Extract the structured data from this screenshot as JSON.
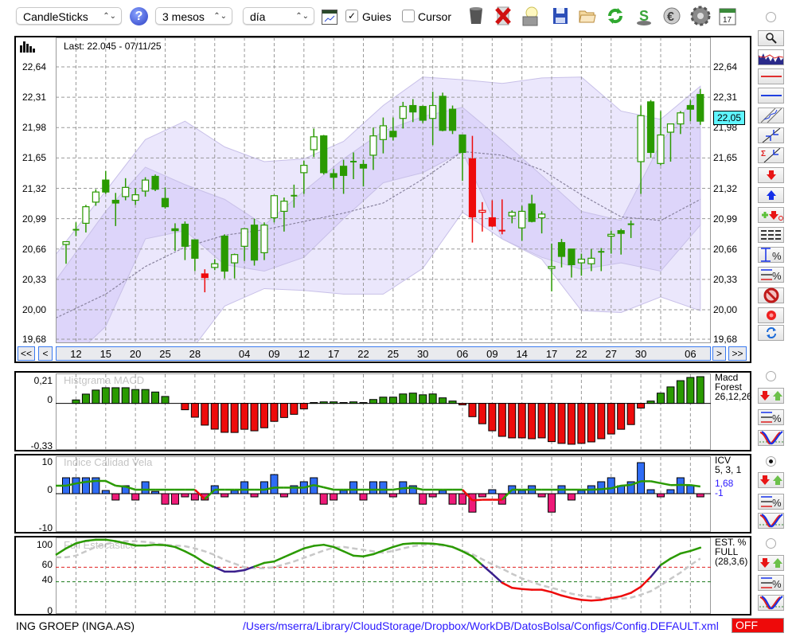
{
  "toolbar": {
    "chart_type": "CandleSticks",
    "period": "3 mesos",
    "interval": "día",
    "guides_label": "Guies",
    "guides_checked": true,
    "cursor_label": "Cursor",
    "cursor_checked": false,
    "icons": [
      "help-icon",
      "chart-window-icon",
      "trash-icon",
      "delete-icon",
      "clear-lamp-icon",
      "save-icon",
      "open-folder-icon",
      "refresh-icon",
      "currency-s-icon",
      "euro-icon",
      "settings-gear-icon",
      "calendar-icon"
    ],
    "calendar_day": "17"
  },
  "main": {
    "last_label": "Last: 22.045 - 07/11/25",
    "last_value_badge": "22,05",
    "y_ticks": [
      {
        "v": 22.64,
        "label": "22,64"
      },
      {
        "v": 22.31,
        "label": "22,31"
      },
      {
        "v": 21.98,
        "label": "21,98"
      },
      {
        "v": 21.65,
        "label": "21,65"
      },
      {
        "v": 21.32,
        "label": "21,32"
      },
      {
        "v": 20.99,
        "label": "20,99"
      },
      {
        "v": 20.66,
        "label": "20,66"
      },
      {
        "v": 20.33,
        "label": "20,33"
      },
      {
        "v": 20.0,
        "label": "20,00"
      },
      {
        "v": 19.68,
        "label": "19,68"
      }
    ],
    "x_ticks": [
      {
        "i": 1,
        "label": "12"
      },
      {
        "i": 4,
        "label": "15"
      },
      {
        "i": 7,
        "label": "20"
      },
      {
        "i": 10,
        "label": "25"
      },
      {
        "i": 13,
        "label": "28"
      },
      {
        "i": 18,
        "label": "04"
      },
      {
        "i": 21,
        "label": "09"
      },
      {
        "i": 24,
        "label": "12"
      },
      {
        "i": 27,
        "label": "17"
      },
      {
        "i": 30,
        "label": "22"
      },
      {
        "i": 33,
        "label": "25"
      },
      {
        "i": 36,
        "label": "30"
      },
      {
        "i": 40,
        "label": "06"
      },
      {
        "i": 43,
        "label": "09"
      },
      {
        "i": 46,
        "label": "14"
      },
      {
        "i": 49,
        "label": "17"
      },
      {
        "i": 52,
        "label": "22"
      },
      {
        "i": 55,
        "label": "27"
      },
      {
        "i": 58,
        "label": "30"
      },
      {
        "i": 63,
        "label": "06"
      }
    ],
    "month_starts": [
      15,
      37,
      60
    ],
    "nav": {
      "first": "<<",
      "prev": "<",
      "next": ">",
      "last": ">>"
    }
  },
  "chart_data": [
    {
      "type": "candlestick",
      "title": "Last: 22.045 - 07/11/25",
      "ylim": [
        19.68,
        22.64
      ],
      "ohlc": [
        [
          20.71,
          20.74,
          20.5,
          20.74
        ],
        [
          20.87,
          20.95,
          20.8,
          20.87
        ],
        [
          20.94,
          21.14,
          20.84,
          21.12
        ],
        [
          21.17,
          21.31,
          21.13,
          21.28
        ],
        [
          21.41,
          21.51,
          21.26,
          21.28
        ],
        [
          21.19,
          21.27,
          20.91,
          21.16
        ],
        [
          21.23,
          21.43,
          21.19,
          21.33
        ],
        [
          21.19,
          21.32,
          21.14,
          21.25
        ],
        [
          21.29,
          21.44,
          21.23,
          21.41
        ],
        [
          21.45,
          21.47,
          21.29,
          21.31
        ],
        [
          21.21,
          21.33,
          21.1,
          21.12
        ],
        [
          20.88,
          20.94,
          20.64,
          20.86
        ],
        [
          20.93,
          20.96,
          20.54,
          20.69
        ],
        [
          20.76,
          20.76,
          20.42,
          20.56
        ],
        [
          20.39,
          20.44,
          20.19,
          20.35
        ],
        [
          20.46,
          20.55,
          20.43,
          20.5
        ],
        [
          20.8,
          20.82,
          20.34,
          20.42
        ],
        [
          20.51,
          20.61,
          20.34,
          20.6
        ],
        [
          20.69,
          20.88,
          20.53,
          20.88
        ],
        [
          20.92,
          20.99,
          20.48,
          20.54
        ],
        [
          20.62,
          20.95,
          20.54,
          20.92
        ],
        [
          21.0,
          21.25,
          20.95,
          21.24
        ],
        [
          21.07,
          21.22,
          20.85,
          21.18
        ],
        [
          21.24,
          21.36,
          21.11,
          21.24
        ],
        [
          21.49,
          21.62,
          21.26,
          21.57
        ],
        [
          21.74,
          21.97,
          21.66,
          21.88
        ],
        [
          21.89,
          21.9,
          21.47,
          21.49
        ],
        [
          21.48,
          21.53,
          21.31,
          21.44
        ],
        [
          21.56,
          21.63,
          21.26,
          21.46
        ],
        [
          21.61,
          21.71,
          21.42,
          21.61
        ],
        [
          21.58,
          21.63,
          21.34,
          21.54
        ],
        [
          21.68,
          21.98,
          21.52,
          21.89
        ],
        [
          21.85,
          22.09,
          21.7,
          22.0
        ],
        [
          21.94,
          22.09,
          21.84,
          21.88
        ],
        [
          22.08,
          22.26,
          21.97,
          22.21
        ],
        [
          22.22,
          22.29,
          22.04,
          22.15
        ],
        [
          22.21,
          22.22,
          22.03,
          22.06
        ],
        [
          22.08,
          22.37,
          21.79,
          22.22
        ],
        [
          22.32,
          22.36,
          21.94,
          21.95
        ],
        [
          22.18,
          22.22,
          21.91,
          21.95
        ],
        [
          21.9,
          21.9,
          21.4,
          21.71
        ],
        [
          21.64,
          21.89,
          20.73,
          21.01
        ],
        [
          21.06,
          21.17,
          20.85,
          21.08
        ],
        [
          21.0,
          21.19,
          20.9,
          20.91
        ],
        [
          20.86,
          21.2,
          20.82,
          20.86
        ],
        [
          21.02,
          21.08,
          20.94,
          21.06
        ],
        [
          20.89,
          21.13,
          20.75,
          21.07
        ],
        [
          21.15,
          21.25,
          20.95,
          20.96
        ],
        [
          21.0,
          21.07,
          20.83,
          21.04
        ],
        [
          20.45,
          20.72,
          20.2,
          20.47
        ],
        [
          20.73,
          20.77,
          20.46,
          20.58
        ],
        [
          20.66,
          20.66,
          20.35,
          20.49
        ],
        [
          20.51,
          20.61,
          20.37,
          20.55
        ],
        [
          20.5,
          20.66,
          20.42,
          20.56
        ],
        [
          20.63,
          20.67,
          20.42,
          20.63
        ],
        [
          20.8,
          20.86,
          20.61,
          20.82
        ],
        [
          20.86,
          20.88,
          20.6,
          20.83
        ],
        [
          20.93,
          20.97,
          20.78,
          20.93
        ],
        [
          21.61,
          22.22,
          21.26,
          22.11
        ],
        [
          22.26,
          22.28,
          21.65,
          21.71
        ],
        [
          21.59,
          22.16,
          21.57,
          21.9
        ],
        [
          21.93,
          22.02,
          21.61,
          22.02
        ],
        [
          22.02,
          22.16,
          21.91,
          22.14
        ],
        [
          22.22,
          22.28,
          22.05,
          22.18
        ],
        [
          22.34,
          22.4,
          22.01,
          22.05
        ]
      ],
      "red_candles": [
        14,
        41,
        42,
        43,
        44
      ],
      "band_sample_index": [
        0,
        4,
        8,
        12,
        16,
        20,
        24,
        28,
        32,
        36,
        40,
        44,
        48,
        52,
        56,
        60,
        64
      ],
      "outer_upper": [
        20.6,
        21.29,
        21.85,
        22.05,
        21.77,
        21.61,
        21.64,
        21.83,
        22.22,
        22.53,
        22.5,
        22.46,
        22.52,
        22.53,
        22.16,
        22.07,
        22.43
      ],
      "inner_upper": [
        20.32,
        21.07,
        21.55,
        21.36,
        21.2,
        20.92,
        21.29,
        21.64,
        21.94,
        22.1,
        22.2,
        21.84,
        21.46,
        21.07,
        20.97,
        21.81,
        22.39
      ],
      "inner_lower": [
        19.3,
        19.82,
        20.77,
        20.86,
        20.49,
        20.42,
        20.57,
        20.99,
        21.38,
        21.49,
        21.72,
        20.77,
        20.57,
        20.44,
        20.51,
        20.42,
        20.92
      ],
      "outer_lower": [
        18.87,
        19.13,
        19.3,
        19.47,
        20.04,
        20.23,
        20.21,
        20.17,
        20.17,
        20.45,
        21.06,
        20.77,
        20.55,
        19.99,
        19.97,
        20.14,
        19.99
      ],
      "moving_average": [
        19.91,
        20.17,
        20.47,
        20.68,
        20.81,
        20.87,
        20.96,
        21.05,
        21.16,
        21.42,
        21.72,
        21.68,
        21.52,
        21.25,
        21.01,
        20.97,
        21.2
      ]
    },
    {
      "type": "bar",
      "title": "Histgrama MACD",
      "ylim": [
        -0.33,
        0.21
      ],
      "y_tick_labels": [
        "0,21",
        "0",
        "-0,33"
      ],
      "legend": [
        "Macd",
        "Forest",
        "26,12,26"
      ],
      "values": [
        0,
        0.025,
        0.067,
        0.096,
        0.113,
        0.113,
        0.113,
        0.1,
        0.1,
        0.082,
        0.05,
        0,
        -0.046,
        -0.1,
        -0.157,
        -0.186,
        -0.209,
        -0.21,
        -0.187,
        -0.198,
        -0.176,
        -0.13,
        -0.102,
        -0.079,
        -0.04,
        0.006,
        0.011,
        0.011,
        0.006,
        0.011,
        0.006,
        0.028,
        0.045,
        0.045,
        0.068,
        0.074,
        0.062,
        0.068,
        0.04,
        0.017,
        -0.011,
        -0.096,
        -0.147,
        -0.198,
        -0.238,
        -0.249,
        -0.249,
        -0.255,
        -0.249,
        -0.276,
        -0.289,
        -0.295,
        -0.289,
        -0.278,
        -0.255,
        -0.221,
        -0.187,
        -0.153,
        -0.034,
        0.017,
        0.074,
        0.119,
        0.164,
        0.187,
        0.193
      ]
    },
    {
      "type": "bar",
      "title": "Indice Calidad Vela",
      "ylim": [
        -10,
        10
      ],
      "y_tick_labels": [
        "10",
        "0",
        "-10"
      ],
      "legend": [
        "ICV",
        "5, 3, 1"
      ],
      "last_values": [
        "1,68",
        "-1"
      ],
      "values": [
        5,
        5,
        5,
        5,
        1,
        -2,
        2.5,
        -2,
        3.75,
        0.7,
        -3.3,
        -3.3,
        -1,
        -2,
        -2,
        2.5,
        -1,
        1,
        3.75,
        -1,
        3.75,
        6,
        -1,
        2.5,
        3.75,
        5,
        -3.3,
        -2,
        1,
        3.75,
        -2,
        3.75,
        3.75,
        -1,
        3.75,
        2.5,
        -3.3,
        -1,
        1,
        -3.3,
        -3.3,
        -5.8,
        -1,
        1.25,
        -3.3,
        2.5,
        1,
        2.5,
        -1,
        -5.8,
        2.5,
        -2,
        1,
        2.5,
        3.75,
        5,
        2.5,
        3.75,
        9.75,
        1.25,
        -1,
        1.25,
        5,
        2.5,
        -1
      ],
      "signal": [
        2.5,
        3.2,
        3.7,
        4,
        4,
        2.5,
        2.2,
        1.25,
        1.25,
        1.25,
        1.25,
        1.25,
        1.25,
        1.25,
        -1.7,
        1.25,
        1.25,
        1.25,
        1.25,
        1.25,
        1.25,
        1.9,
        1.9,
        1.9,
        1.9,
        2.7,
        2,
        1.25,
        1.25,
        1.25,
        1.25,
        1.25,
        1.25,
        1.25,
        1.7,
        1.9,
        1.25,
        1.25,
        1.25,
        1.25,
        1.25,
        -2.1,
        -1.9,
        -1.9,
        -1.9,
        1.25,
        1.25,
        1.25,
        1.25,
        1.25,
        1.25,
        1.25,
        1.25,
        1.25,
        1.4,
        1.7,
        2.5,
        2.75,
        3.9,
        3.9,
        3.3,
        2.7,
        2.75,
        2.7,
        2.25
      ]
    },
    {
      "type": "line",
      "title": "Full Estocastico",
      "ylim": [
        0,
        100
      ],
      "y_tick_labels": [
        "100",
        "60",
        "40",
        "0"
      ],
      "reference_lines": [
        60,
        40
      ],
      "legend": [
        "EST. %",
        "FULL",
        "(28,3,6)"
      ],
      "k": [
        86,
        93,
        96.5,
        98,
        98,
        96,
        93,
        90,
        90,
        91,
        90.5,
        88,
        82,
        75,
        66,
        60,
        54,
        54,
        56,
        61,
        66,
        68,
        74,
        80,
        86,
        89.5,
        91,
        88,
        82,
        76,
        75,
        78,
        83,
        88,
        92,
        93,
        93,
        92.6,
        91,
        88,
        82,
        75,
        63,
        51,
        38.6,
        31.6,
        30,
        29,
        29,
        25.6,
        21,
        17.5,
        15,
        14,
        15,
        17.5,
        20,
        24.6,
        33,
        46.7,
        63,
        72,
        79,
        82.5,
        87
      ],
      "d": [
        73.7,
        76,
        82,
        88,
        92,
        95,
        96,
        96,
        95,
        93,
        91,
        90,
        89,
        86,
        82,
        77,
        70,
        65,
        60,
        58.6,
        58.6,
        60,
        64,
        68,
        73,
        78,
        83,
        87,
        88,
        86,
        84,
        82,
        80,
        82.5,
        86,
        89,
        91,
        91,
        90,
        88,
        83,
        78,
        71,
        64,
        58,
        51,
        44.6,
        39.6,
        35,
        31.6,
        28,
        23.5,
        21,
        19.3,
        17.5,
        16.5,
        16.5,
        18,
        22,
        27,
        35,
        44,
        52.6,
        63,
        72
      ]
    }
  ],
  "status": {
    "instrument": "ING GROEP (INGA.AS)",
    "config_path": "/Users/mserra/Library/CloudStorage/Dropbox/WorkDB/DatosBolsa/Configs/Config.DEFAULT.xml",
    "off_button": "OFF"
  },
  "colors": {
    "up_green": "#2a9a00",
    "red": "#ee0b0b",
    "icv_blue": "#2f6cf5",
    "icv_pink": "#ee1a78",
    "stoch_purple": "#3a1f8c",
    "band_outer": "#ebe7fc",
    "band_inner": "#ddd5fa",
    "badge_cyan": "#5ff5ff",
    "path_blue": "#2a18ff"
  }
}
